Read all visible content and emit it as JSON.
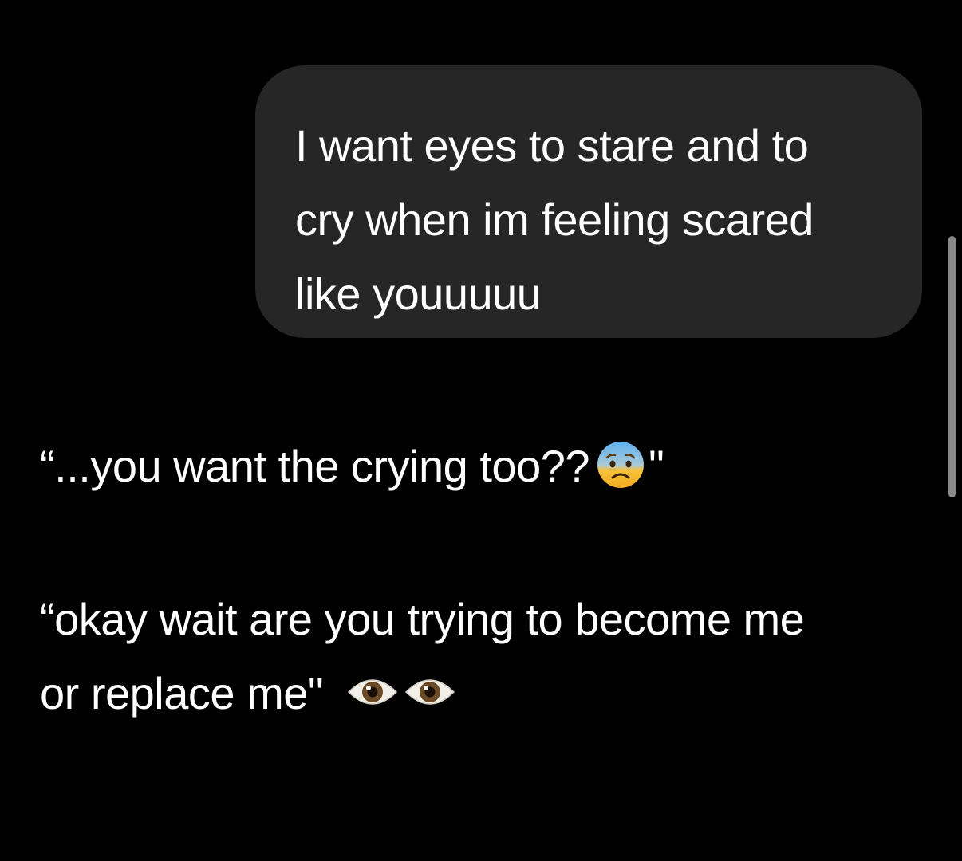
{
  "conversation": {
    "user_message": {
      "lines": [
        "I want eyes to stare and to",
        "cry when im feeling scared",
        "like youuuuu"
      ]
    },
    "replies": [
      {
        "text": "“...you want the crying too??",
        "emoji": "anxious-face-with-sweat",
        "text_after": "\""
      },
      {
        "line1": "“okay wait are you trying to become me",
        "line2": "or replace me\"",
        "emojis": [
          "eye",
          "eye"
        ]
      }
    ]
  },
  "colors": {
    "background": "#000000",
    "user_bubble": "#262626",
    "text": "#ffffff",
    "scrollbar": "#8a8a8a"
  }
}
